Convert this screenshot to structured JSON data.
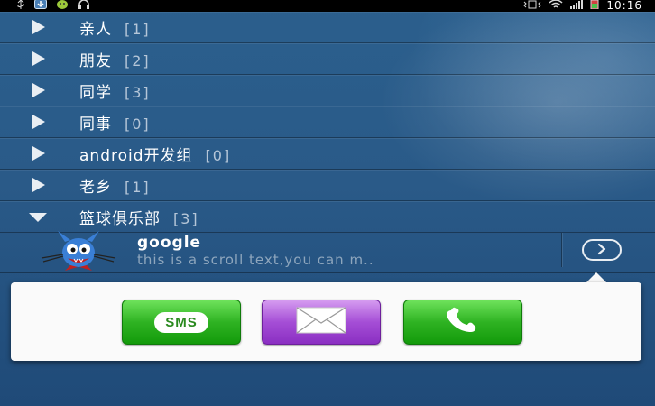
{
  "status_bar": {
    "time": "10:16",
    "left_icons": [
      "usb-icon",
      "download-icon",
      "android-icon",
      "headset-icon"
    ],
    "right_icons": [
      "vibrate-icon",
      "wifi-icon",
      "signal-icon",
      "battery-icon"
    ]
  },
  "groups": [
    {
      "name": "亲人",
      "count": "[1]",
      "expanded": false
    },
    {
      "name": "朋友",
      "count": "[2]",
      "expanded": false
    },
    {
      "name": "同学",
      "count": "[3]",
      "expanded": false
    },
    {
      "name": "同事",
      "count": "[0]",
      "expanded": false
    },
    {
      "name": "android开发组",
      "count": "[0]",
      "expanded": false
    },
    {
      "name": "老乡",
      "count": "[1]",
      "expanded": false
    },
    {
      "name": "篮球俱乐部",
      "count": "[3]",
      "expanded": true
    }
  ],
  "contact": {
    "name": "google",
    "status": "this is a scroll text,you can m..",
    "detail_icon": "chevron-right-circle-icon"
  },
  "actions": [
    {
      "id": "sms",
      "label": "SMS",
      "icon": "sms-icon",
      "color": "#2fb323"
    },
    {
      "id": "email",
      "icon": "email-icon",
      "color": "#a54ed6"
    },
    {
      "id": "call",
      "icon": "phone-icon",
      "color": "#2fb323"
    }
  ]
}
